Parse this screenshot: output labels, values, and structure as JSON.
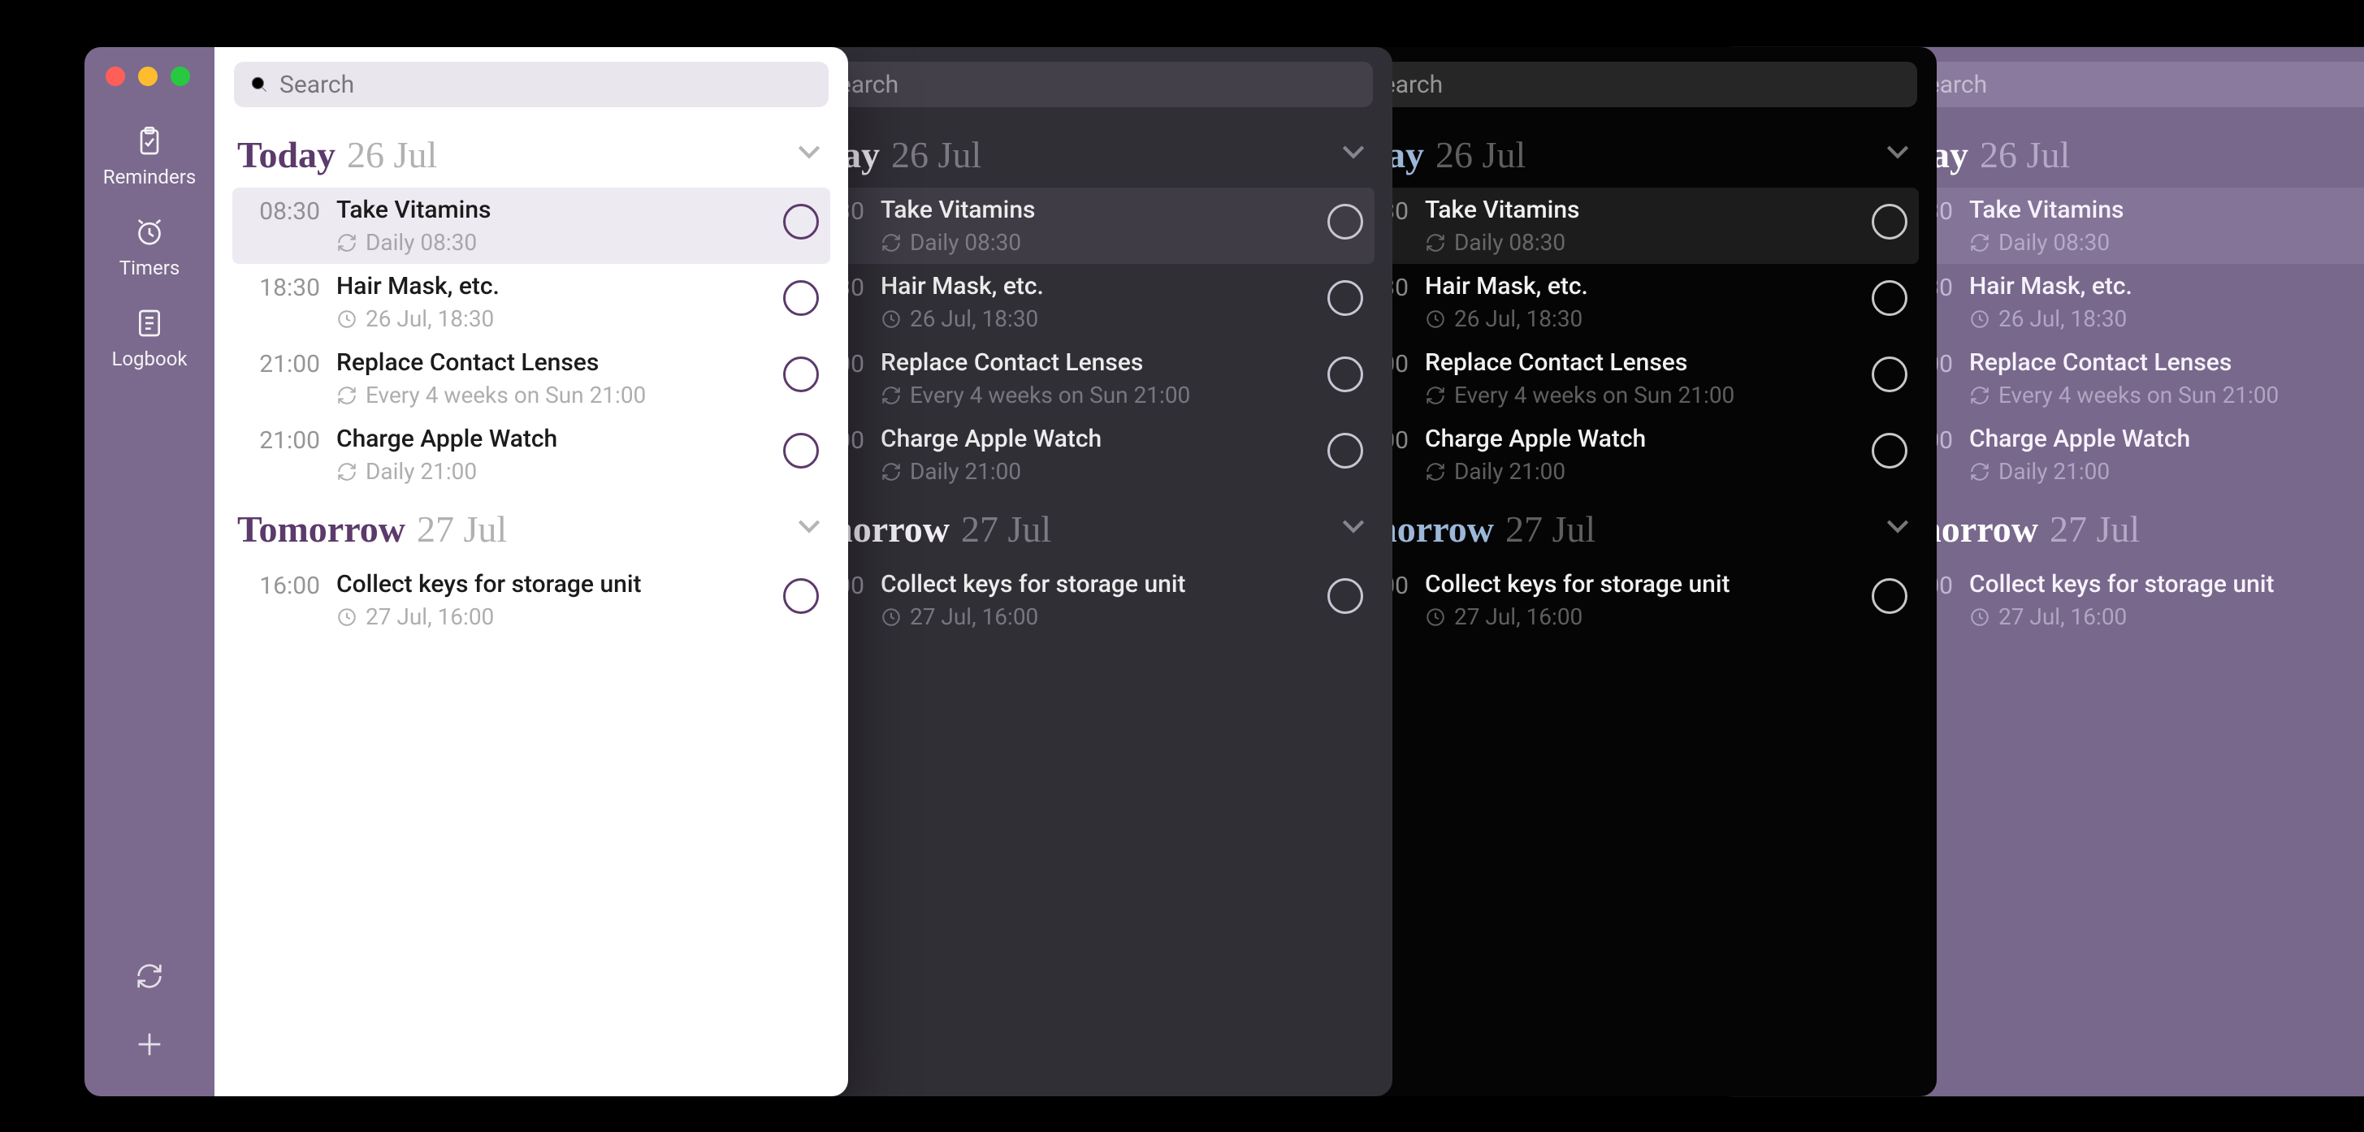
{
  "search": {
    "placeholder": "Search"
  },
  "sidebar": {
    "reminders": "Reminders",
    "timers": "Timers",
    "logbook": "Logbook"
  },
  "sections": [
    {
      "title": "Today",
      "date": "26 Jul",
      "items": [
        {
          "time": "08:30",
          "title": "Take Vitamins",
          "meta_kind": "repeat",
          "meta": "Daily 08:30",
          "selected": true
        },
        {
          "time": "18:30",
          "title": "Hair Mask, etc.",
          "meta_kind": "clock",
          "meta": "26 Jul, 18:30",
          "selected": false
        },
        {
          "time": "21:00",
          "title": "Replace Contact Lenses",
          "meta_kind": "repeat",
          "meta": "Every 4 weeks on Sun 21:00",
          "selected": false
        },
        {
          "time": "21:00",
          "title": "Charge Apple Watch",
          "meta_kind": "repeat",
          "meta": "Daily 21:00",
          "selected": false
        }
      ]
    },
    {
      "title": "Tomorrow",
      "date": "27 Jul",
      "items": [
        {
          "time": "16:00",
          "title": "Collect keys for storage unit",
          "meta_kind": "clock",
          "meta": "27 Jul, 16:00",
          "selected": false
        }
      ]
    }
  ],
  "windows": [
    {
      "theme": "a",
      "pos": "win-a",
      "traffic": "color"
    },
    {
      "theme": "b",
      "pos": "win-b",
      "traffic": "dim"
    },
    {
      "theme": "c",
      "pos": "win-c",
      "traffic": "dim"
    },
    {
      "theme": "d",
      "pos": "win-d",
      "traffic": "dim"
    }
  ]
}
